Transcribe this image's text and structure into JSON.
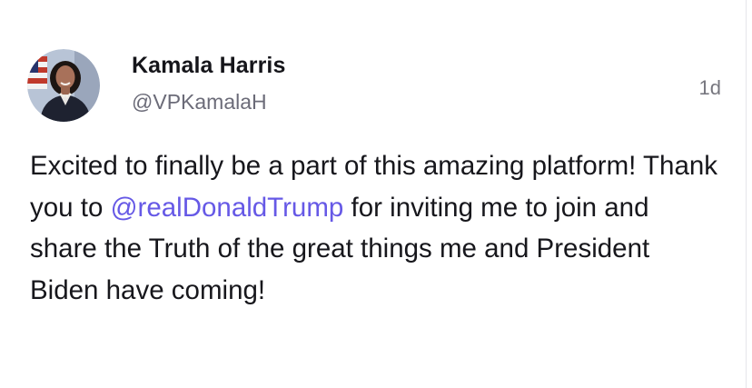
{
  "post": {
    "author": {
      "name": "Kamala Harris",
      "handle": "@VPKamalaH"
    },
    "timestamp": "1d",
    "body_before": "Excited to finally be a part of this amazing platform! Thank you to ",
    "mention": "@realDonaldTrump",
    "body_after": " for inviting me to join and share the Truth of the great things me and President Biden have coming!"
  },
  "colors": {
    "mention": "#6659e6",
    "name": "#15151a",
    "handle": "#6b6b78",
    "text": "#17171c"
  },
  "icons": {
    "avatar": "profile-photo"
  }
}
